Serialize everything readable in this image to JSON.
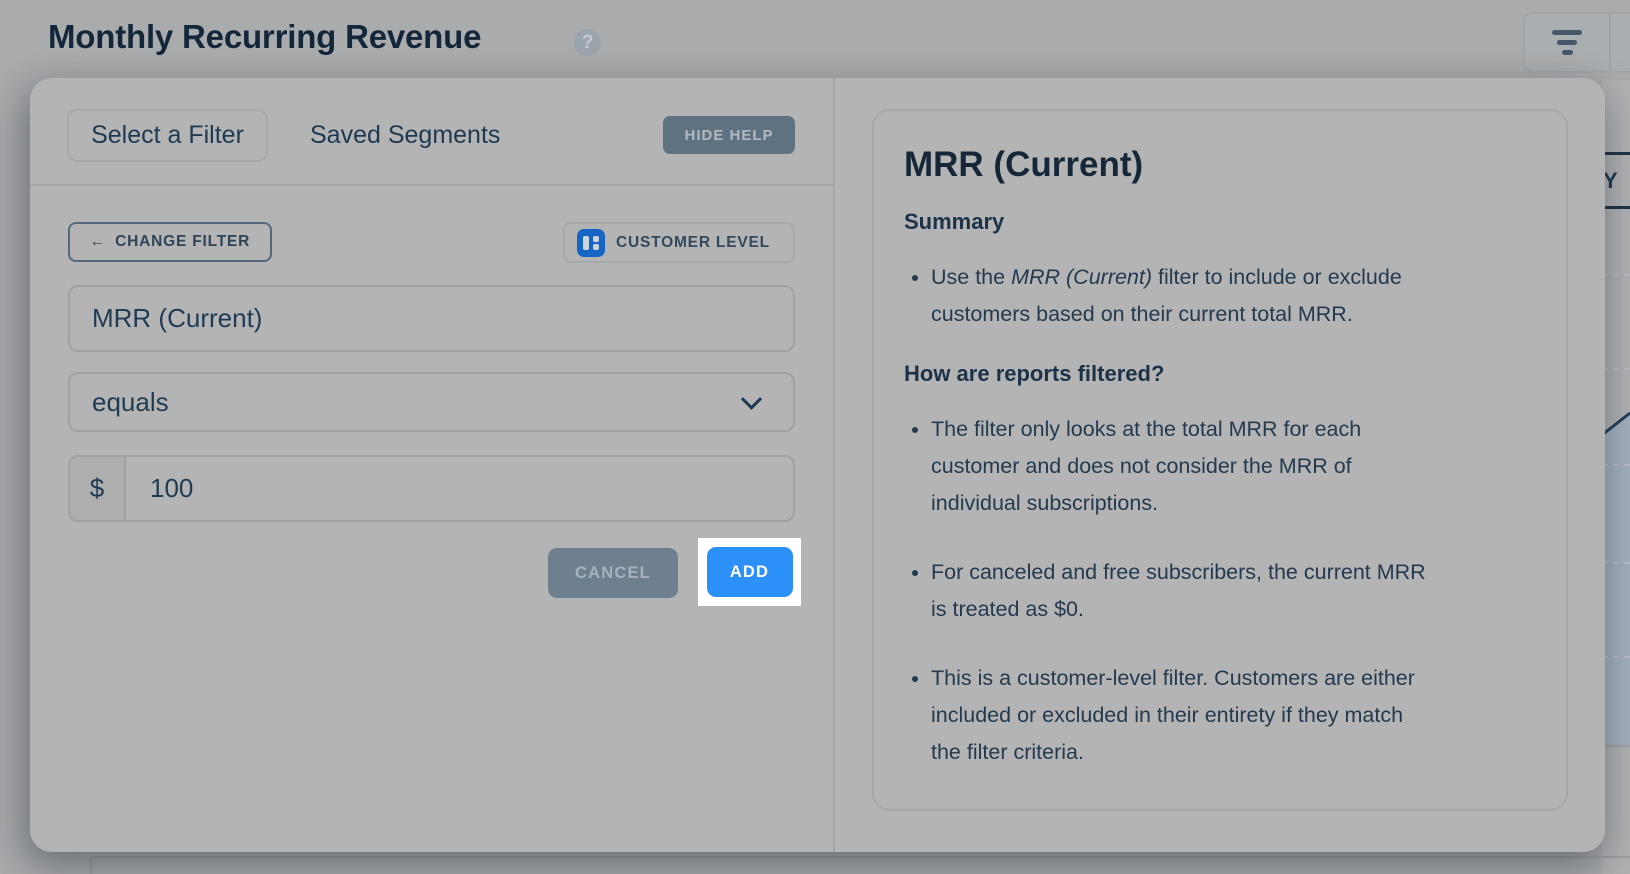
{
  "page": {
    "title": "Monthly Recurring Revenue",
    "help_badge": "?",
    "chart_tab_partial": "Y"
  },
  "filter_panel": {
    "tabs": {
      "select": "Select a Filter",
      "saved": "Saved Segments"
    },
    "hide_help_label": "HIDE HELP",
    "back_arrow": "←",
    "change_filter_label": "CHANGE FILTER",
    "level_badge_label": "CUSTOMER LEVEL",
    "filter_name_value": "MRR (Current)",
    "operator_value": "equals",
    "currency_symbol": "$",
    "amount_value": "100",
    "cancel_label": "CANCEL",
    "add_label": "ADD"
  },
  "help_panel": {
    "title": "MRR (Current)",
    "summary_heading": "Summary",
    "summary_bullet": {
      "pre": "Use the ",
      "italic": "MRR (Current)",
      "post": " filter to include or exclude\ncustomers based on their current total MRR."
    },
    "filtered_heading": "How are reports filtered?",
    "bullets": [
      "The filter only looks at the total MRR for each\ncustomer and does not consider the MRR of\nindividual subscriptions.",
      "For canceled and free subscribers, the current MRR\nis treated as $0.",
      "This is a customer-level filter. Customers are either\nincluded or excluded in their entirety if they match\nthe filter criteria."
    ]
  },
  "colors": {
    "accent_blue": "#2b90f8",
    "spotlight": "#ffffff",
    "dark_navy": "#1e3954",
    "slate_button": "#5e7282",
    "badge_icon_blue": "#1566c4"
  }
}
